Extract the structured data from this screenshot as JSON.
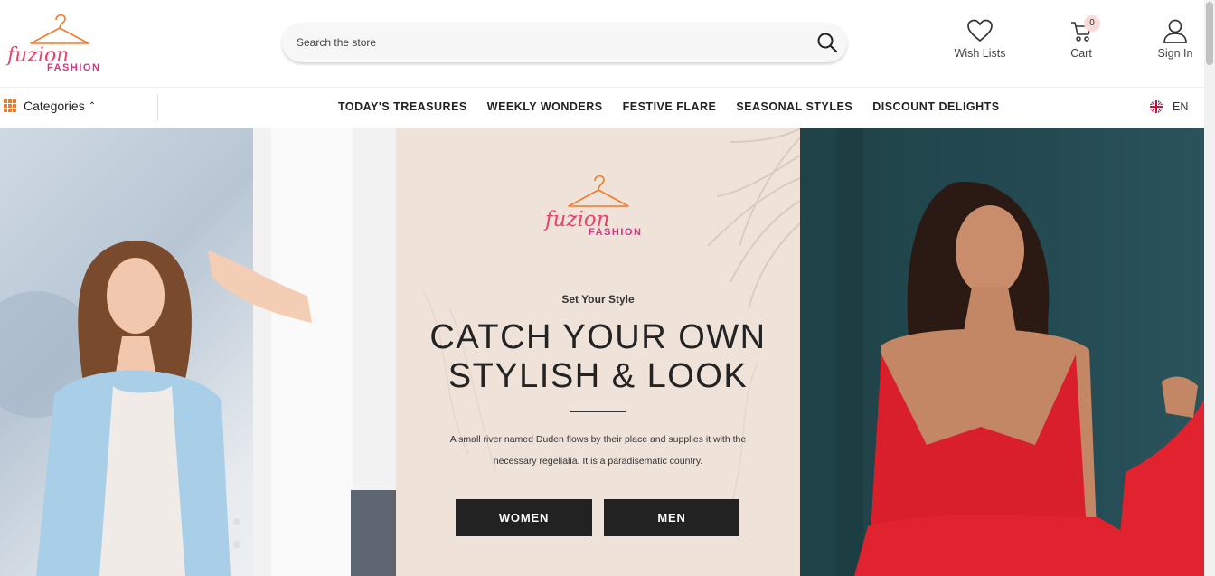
{
  "header": {
    "logo": {
      "script": "fuzion",
      "word": "FASHION",
      "colors": {
        "script": "#e8436b",
        "word": "#d63384",
        "hanger": "#f07b2a"
      }
    },
    "search": {
      "placeholder": "Search the store",
      "value": ""
    },
    "actions": {
      "wishlist_label": "Wish Lists",
      "cart_label": "Cart",
      "cart_count": "0",
      "signin_label": "Sign In"
    }
  },
  "nav": {
    "categories_label": "Categories",
    "links": [
      "TODAY'S TREASURES",
      "WEEKLY WONDERS",
      "FESTIVE FLARE",
      "SEASONAL STYLES",
      "DISCOUNT DELIGHTS"
    ],
    "language": "EN"
  },
  "hero": {
    "tagline": "Set Your Style",
    "headline_line1": "CATCH YOUR OWN",
    "headline_line2": "STYLISH & LOOK",
    "description": "A small river named Duden flows by their place and supplies it with the necessary regelialia. It is a paradisematic country.",
    "buttons": {
      "women": "WOMEN",
      "men": "MEN"
    }
  },
  "colors": {
    "accent": "#f07b2a",
    "brand_pink": "#e8436b",
    "cta_bg": "#222222",
    "hero_mid_bg": "#efe3d9"
  }
}
